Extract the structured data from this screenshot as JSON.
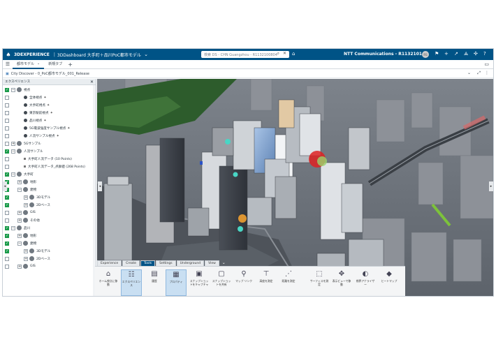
{
  "topbar": {
    "brand": "3DEXPERIENCE",
    "sep": "|",
    "title": "3DDashboard 大手町＋品川PoC都市モデル",
    "search_placeholder": "検索 DS - CHN Guangzhou - R1132100804",
    "user": "NTT Communications - R1132101",
    "avatar": "RS"
  },
  "tabs": [
    {
      "label": "都市モデル"
    },
    {
      "label": "新規タブ"
    }
  ],
  "widget_title": "City Discover - 0_PoC都市モデル_001_Release",
  "tree": {
    "header": "エクスペリエンス",
    "items": [
      {
        "label": "視点"
      },
      {
        "label": "全体視点"
      },
      {
        "label": "大手町視点"
      },
      {
        "label": "東京駅前視点"
      },
      {
        "label": "品川視点"
      },
      {
        "label": "5G電波強度サンプル視点"
      },
      {
        "label": "人流サンプル視点"
      },
      {
        "label": "5Gサンプル"
      },
      {
        "label": "人流サンプル"
      },
      {
        "label": "大手町人流データ (10 Points)"
      },
      {
        "label": "大手町人流データ_点群値 (268 Points)"
      },
      {
        "label": "大手町"
      },
      {
        "label": "地形"
      },
      {
        "label": "建物"
      },
      {
        "label": "3Dモデル"
      },
      {
        "label": "2Dベース"
      },
      {
        "label": "GIS"
      },
      {
        "label": "その他"
      },
      {
        "label": "品川"
      },
      {
        "label": "地形"
      },
      {
        "label": "建物"
      },
      {
        "label": "3Dモデル"
      },
      {
        "label": "2Dベース"
      },
      {
        "label": "GIS"
      }
    ]
  },
  "toolbar": {
    "tabs": [
      "Experience",
      "Create",
      "Tools",
      "Settings",
      "Underground",
      "View"
    ],
    "buttons": [
      {
        "label": "ホーム視点に移動"
      },
      {
        "label": "エクスペリエンス"
      },
      {
        "label": "履歴"
      },
      {
        "label": "プロパティ"
      },
      {
        "label": "スナップショットをキャプチャ"
      },
      {
        "label": "スナップショットを共有"
      },
      {
        "label": "マップ リンク"
      },
      {
        "label": "高度を測定"
      },
      {
        "label": "距離を測定"
      },
      {
        "label": "サーフェスを測定"
      },
      {
        "label": "表示ビューで移動"
      },
      {
        "label": "視界アナライザー"
      },
      {
        "label": "ヒートマップ"
      }
    ]
  },
  "colors": {
    "topbar": "#005386",
    "checkbox_on": "#1a9a4a",
    "selected_tool": "#c9dff2"
  }
}
